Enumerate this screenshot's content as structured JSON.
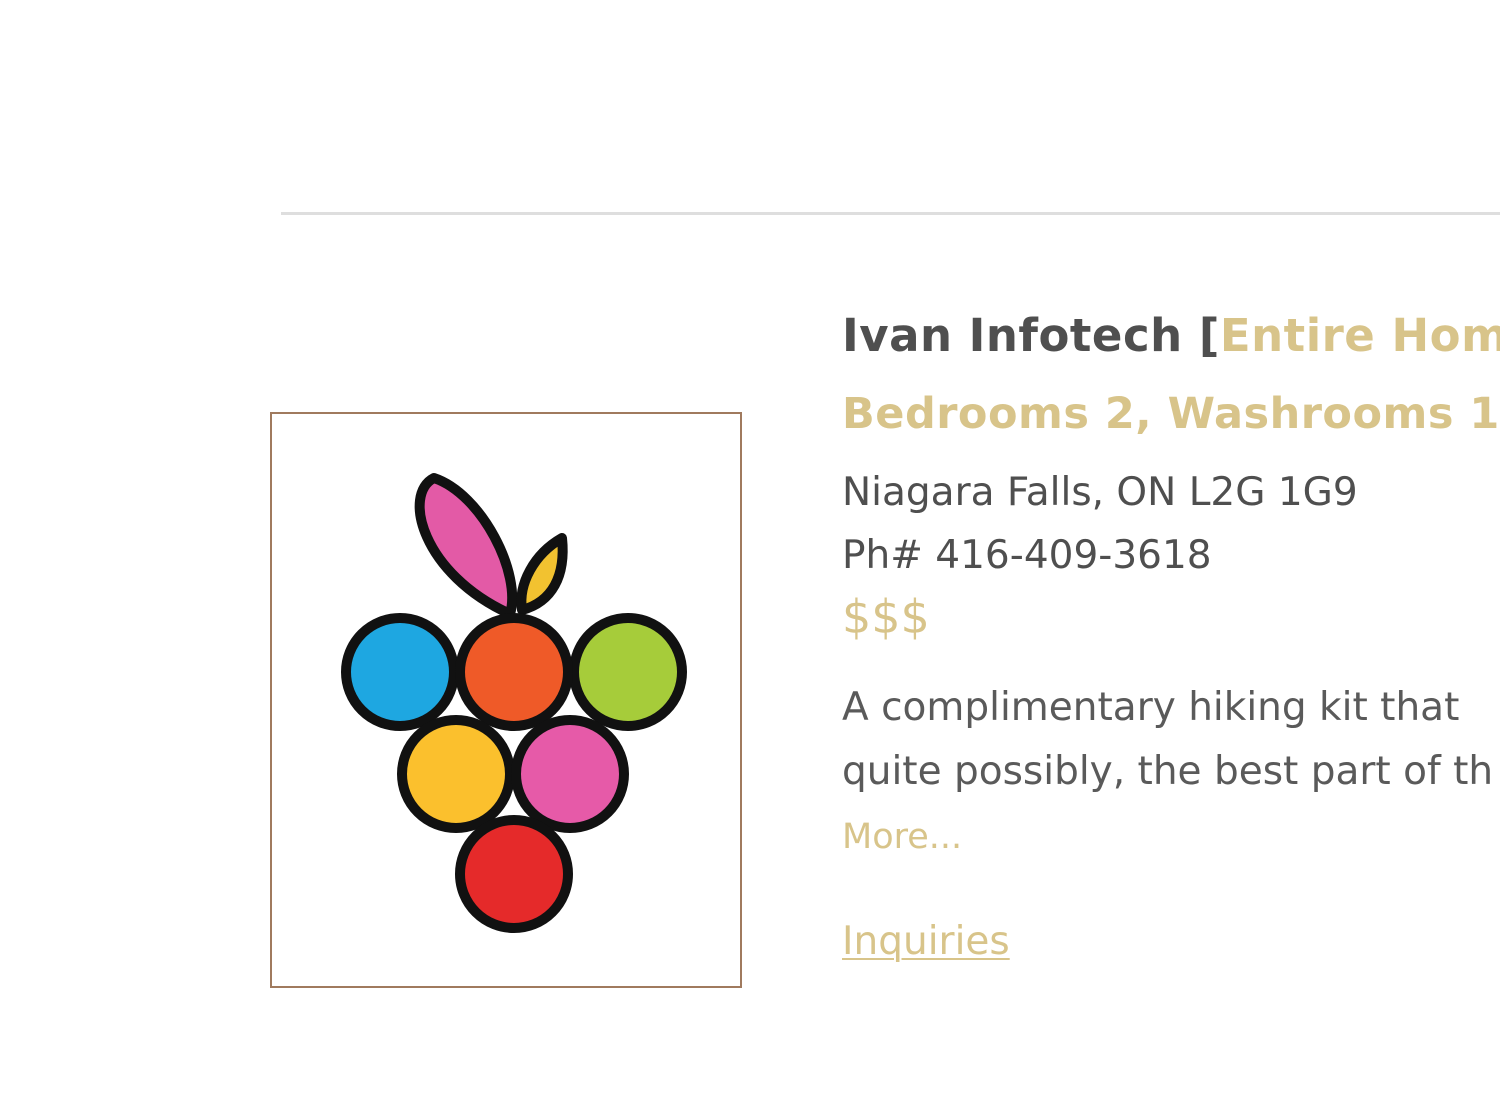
{
  "listing": {
    "name": "Ivan Infotech",
    "bracket_open": " [",
    "type_label": "Entire Home",
    "bracket_close": "]",
    "rooms": "Bedrooms 2, Washrooms 1",
    "address": "Niagara Falls, ON L2G 1G9",
    "phone": "Ph# 416-409-3618",
    "price": "$$$",
    "description": "A complimentary hiking kit that quite possibly, the best part of th",
    "more_label": "More...",
    "inquiries_label": "Inquiries"
  },
  "logo": {
    "icon": "grape-cluster-logo",
    "colors": {
      "leaf_large": "#e35aa6",
      "leaf_small": "#f2c230",
      "grape_blue": "#1ea7e1",
      "grape_orange": "#ef5a28",
      "grape_green": "#a6cc3a",
      "grape_yellow": "#fbc02d",
      "grape_pink": "#e65aa8",
      "grape_red": "#e52a2a",
      "outline": "#111111"
    }
  },
  "colors": {
    "accent": "#d8c48a",
    "text": "#4f4f4f",
    "frame_border": "#a07a5e",
    "divider": "#dedede"
  }
}
